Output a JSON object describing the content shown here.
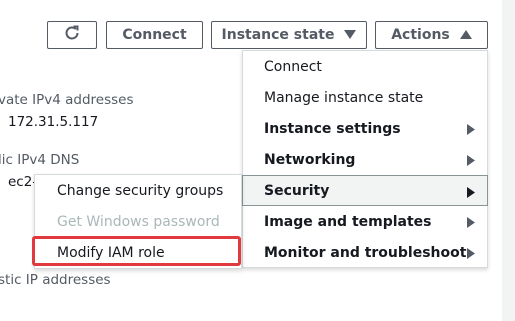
{
  "toolbar": {
    "refresh_icon": "refresh-icon",
    "connect_label": "Connect",
    "instance_state_label": "Instance state",
    "actions_label": "Actions"
  },
  "details": {
    "private_ipv4_label": "vate IPv4 addresses",
    "private_ipv4_value": "172.31.5.117",
    "public_dns_label": "lic IPv4 DNS",
    "public_dns_value": "ec2-",
    "elastic_ip_label": "stic IP addresses"
  },
  "actions_menu": {
    "items": [
      {
        "label": "Connect"
      },
      {
        "label": "Manage instance state"
      },
      {
        "label": "Instance settings"
      },
      {
        "label": "Networking"
      },
      {
        "label": "Security"
      },
      {
        "label": "Image and templates"
      },
      {
        "label": "Monitor and troubleshoot"
      }
    ]
  },
  "security_submenu": {
    "items": [
      {
        "label": "Change security groups"
      },
      {
        "label": "Get Windows password"
      },
      {
        "label": "Modify IAM role"
      }
    ]
  },
  "colors": {
    "highlight_border": "#e0393e",
    "text": "#16191f",
    "disabled_text": "#aab7b8"
  }
}
